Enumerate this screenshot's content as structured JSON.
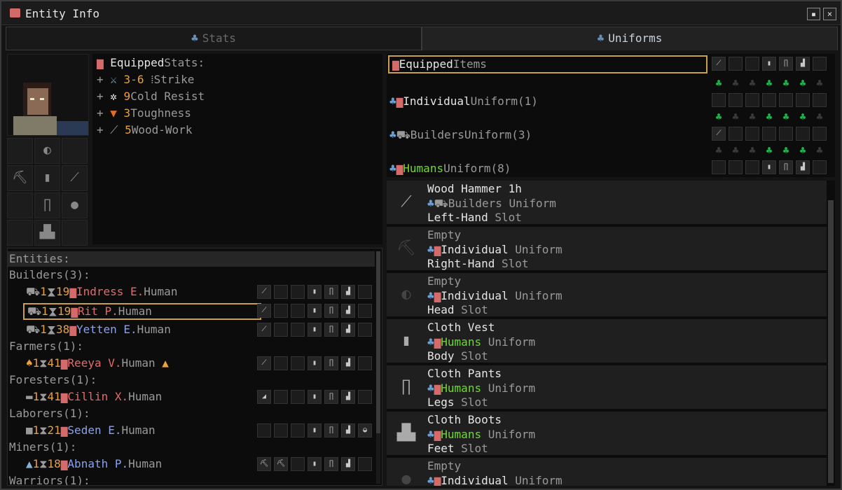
{
  "window": {
    "title": "Entity Info",
    "restore_glyph": "▪",
    "close_glyph": "×"
  },
  "tabs": [
    {
      "label": "Stats",
      "active": false
    },
    {
      "label": "Uniforms",
      "active": true
    }
  ],
  "stats": {
    "header_a": "Equipped",
    "header_b": "Stats:",
    "rows": [
      {
        "a": "3",
        "b": "-",
        "c": "6",
        "d": "Strike"
      },
      {
        "a": "9",
        "d": "Cold Resist"
      },
      {
        "a": "3",
        "d": "Toughness"
      },
      {
        "a": "5",
        "d": "Wood-Work"
      }
    ]
  },
  "entities": {
    "header": "Entities:",
    "groups": [
      {
        "label": "Builders(3):"
      },
      {
        "label": "Farmers(1):"
      },
      {
        "label": "Foresters(1):"
      },
      {
        "label": "Laborers(1):"
      },
      {
        "label": "Miners(1):"
      },
      {
        "label": "Warriors(1):"
      }
    ],
    "rows": [
      {
        "lvl": "1",
        "age": "19",
        "name": "Indress E.",
        "race": "Human"
      },
      {
        "lvl": "1",
        "age": "19",
        "name": "Rit P.",
        "race": "Human"
      },
      {
        "lvl": "1",
        "age": "38",
        "name": "Yetten E.",
        "race": "Human"
      },
      {
        "lvl": "1",
        "age": "41",
        "name": "Reeya V.",
        "race": "Human"
      },
      {
        "lvl": "1",
        "age": "41",
        "name": "Cillin X.",
        "race": "Human"
      },
      {
        "lvl": "1",
        "age": "21",
        "name": "Seden E.",
        "race": "Human"
      },
      {
        "lvl": "1",
        "age": "18",
        "name": "Abnath P.",
        "race": "Human"
      }
    ]
  },
  "uniforms": {
    "equipped_a": "Equipped",
    "equipped_b": "Items",
    "rows": [
      {
        "name": "Individual",
        "suffix": "Uniform(1)"
      },
      {
        "name": "Builders",
        "suffix": "Uniform(3)"
      },
      {
        "name": "Humans",
        "suffix": "Uniform(8)"
      }
    ]
  },
  "items": [
    {
      "name": "Wood Hammer 1h",
      "uniform": "Builders",
      "uniform_word": "Uniform",
      "slot": "Left-Hand",
      "slot_word": "Slot"
    },
    {
      "name": "Empty",
      "uniform": "Individual",
      "uniform_word": "Uniform",
      "slot": "Right-Hand",
      "slot_word": "Slot"
    },
    {
      "name": "Empty",
      "uniform": "Individual",
      "uniform_word": "Uniform",
      "slot": "Head",
      "slot_word": "Slot"
    },
    {
      "name": "Cloth Vest",
      "uniform": "Humans",
      "uniform_word": "Uniform",
      "slot": "Body",
      "slot_word": "Slot"
    },
    {
      "name": "Cloth Pants",
      "uniform": "Humans",
      "uniform_word": "Uniform",
      "slot": "Legs",
      "slot_word": "Slot"
    },
    {
      "name": "Cloth Boots",
      "uniform": "Humans",
      "uniform_word": "Uniform",
      "slot": "Feet",
      "slot_word": "Slot"
    },
    {
      "name": "Empty",
      "uniform": "Individual",
      "uniform_word": "Uniform",
      "slot": "",
      "slot_word": ""
    }
  ],
  "colors": {
    "accent": "#c8a050",
    "green": "#1fae4a",
    "red_name": "#e46b6b",
    "blue_name": "#8aa0f0",
    "humans_green": "#6bdc2a"
  }
}
